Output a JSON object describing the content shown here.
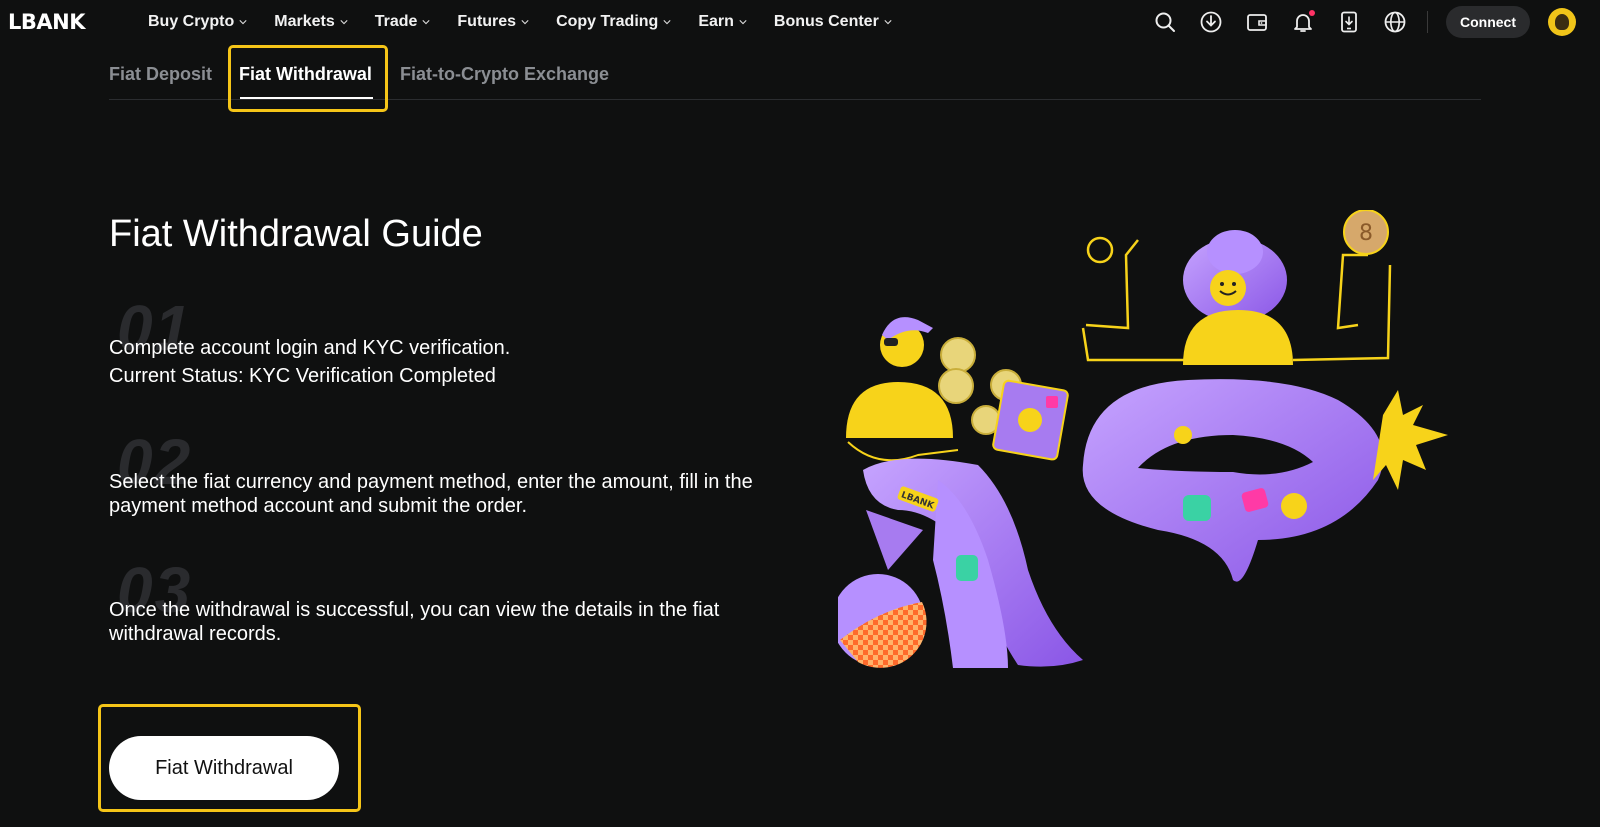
{
  "brand": {
    "logo_text": "LBANK"
  },
  "nav": {
    "items": [
      {
        "label": "Buy Crypto"
      },
      {
        "label": "Markets"
      },
      {
        "label": "Trade"
      },
      {
        "label": "Futures"
      },
      {
        "label": "Copy Trading"
      },
      {
        "label": "Earn"
      },
      {
        "label": "Bonus Center"
      }
    ]
  },
  "toolbar": {
    "icons": [
      "search-icon",
      "download-icon",
      "wallet-icon",
      "bell-icon",
      "app-download-icon",
      "globe-icon"
    ],
    "connect_label": "Connect"
  },
  "tabs": [
    {
      "label": "Fiat Deposit",
      "active": false
    },
    {
      "label": "Fiat Withdrawal",
      "active": true
    },
    {
      "label": "Fiat-to-Crypto Exchange",
      "active": false
    }
  ],
  "guide": {
    "title": "Fiat Withdrawal Guide",
    "steps": [
      {
        "number": "01",
        "line1": "Complete account login and KYC verification.",
        "line2": "Current Status: KYC Verification Completed"
      },
      {
        "number": "02",
        "line1": "Select the fiat currency and payment method, enter the amount, fill in the",
        "line2": "payment method account and submit the order."
      },
      {
        "number": "03",
        "line1": "Once the withdrawal is successful, you can view the details in the fiat",
        "line2": "withdrawal records."
      }
    ],
    "cta_label": "Fiat Withdrawal"
  },
  "illustration": {
    "badge_text": "LBANK"
  },
  "colors": {
    "background": "#0f1010",
    "highlight": "#f5c518",
    "accent_purple": "#a77bf0",
    "accent_yellow": "#f7d31a"
  }
}
